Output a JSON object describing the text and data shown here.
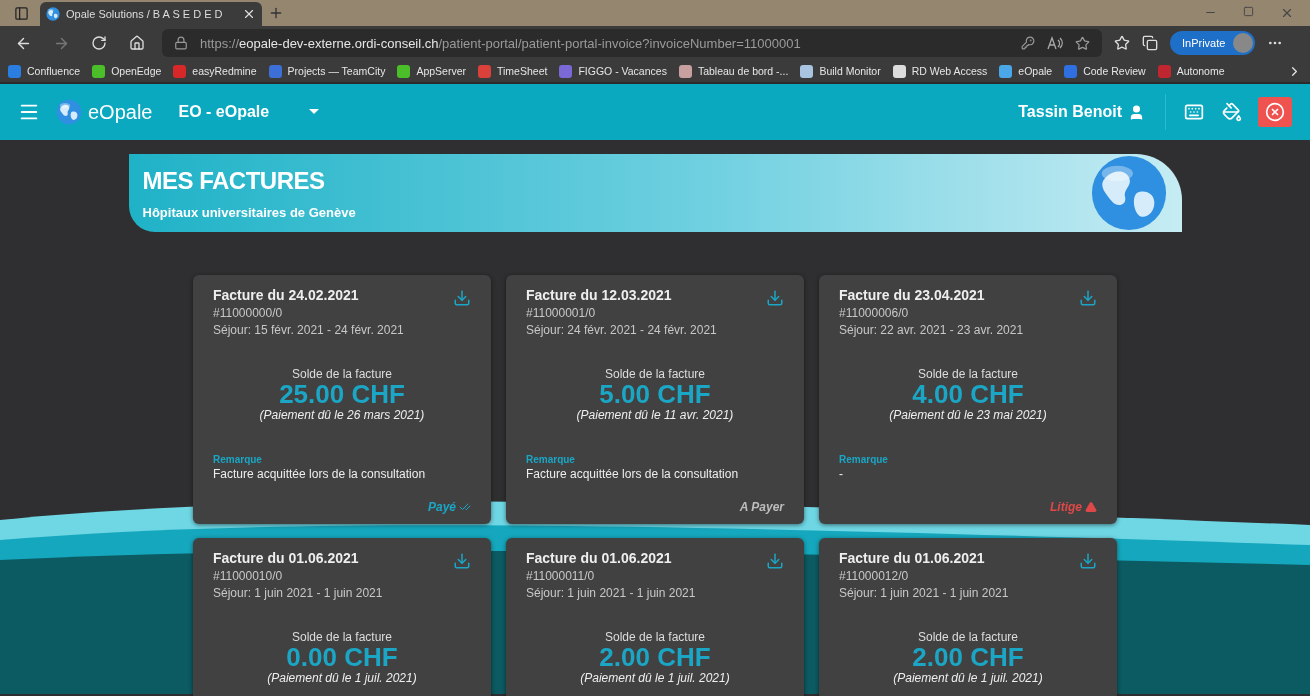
{
  "browser": {
    "tab_title": "Opale Solutions / B A S E D E D",
    "url": {
      "scheme": "https://",
      "host": "eopale-dev-externe.ordi-conseil.ch",
      "path": "/patient-portal/patient-portal-invoice?invoiceNumber=11000001"
    },
    "profile_label": "InPrivate",
    "bookmarks": [
      {
        "label": "Confluence",
        "color": "#2a7de1"
      },
      {
        "label": "OpenEdge",
        "color": "#4bbf2a"
      },
      {
        "label": "easyRedmine",
        "color": "#d62828"
      },
      {
        "label": "Projects — TeamCity",
        "color": "#3c6fd8"
      },
      {
        "label": "AppServer",
        "color": "#4bbf2a"
      },
      {
        "label": "TimeSheet",
        "color": "#d9413a"
      },
      {
        "label": "FIGGO - Vacances",
        "color": "#7a6ad8"
      },
      {
        "label": "Tableau de bord -...",
        "color": "#c9a0a0"
      },
      {
        "label": "Build Monitor",
        "color": "#a8c4e0"
      },
      {
        "label": "RD Web Access",
        "color": "#dddddd"
      },
      {
        "label": "eOpale",
        "color": "#4aa8e8"
      },
      {
        "label": "Code Review",
        "color": "#2f6fe0"
      },
      {
        "label": "Autonome",
        "color": "#c0262f"
      }
    ]
  },
  "app": {
    "brand": "eOpale",
    "workspace": "EO - eOpale",
    "user": "Tassin Benoit"
  },
  "banner": {
    "title": "MES FACTURES",
    "subtitle": "Hôpitaux universitaires de Genève"
  },
  "invoices": [
    {
      "title": "Facture du 24.02.2021",
      "number": "#11000000/0",
      "stay": "Séjour: 15 févr. 2021 - 24 févr. 2021",
      "balance_label": "Solde de la facture",
      "amount": "25.00 CHF",
      "due": "(Paiement dû le 26 mars 2021)",
      "remark_label": "Remarque",
      "remark": "Facture acquittée lors de la consultation",
      "status": {
        "kind": "paid",
        "label": "Payé"
      }
    },
    {
      "title": "Facture du 12.03.2021",
      "number": "#11000001/0",
      "stay": "Séjour: 24 févr. 2021 - 24 févr. 2021",
      "balance_label": "Solde de la facture",
      "amount": "5.00 CHF",
      "due": "(Paiement dû le 11 avr. 2021)",
      "remark_label": "Remarque",
      "remark": "Facture acquittée lors de la consultation",
      "status": {
        "kind": "topay",
        "label": "A Payer"
      }
    },
    {
      "title": "Facture du 23.04.2021",
      "number": "#11000006/0",
      "stay": "Séjour: 22 avr. 2021 - 23 avr. 2021",
      "balance_label": "Solde de la facture",
      "amount": "4.00 CHF",
      "due": "(Paiement dû le 23 mai 2021)",
      "remark_label": "Remarque",
      "remark": "-",
      "status": {
        "kind": "dispute",
        "label": "Litige"
      }
    },
    {
      "title": "Facture du 01.06.2021",
      "number": "#11000010/0",
      "stay": "Séjour: 1 juin 2021 - 1 juin 2021",
      "balance_label": "Solde de la facture",
      "amount": "0.00 CHF",
      "due": "(Paiement dû le 1 juil. 2021)"
    },
    {
      "title": "Facture du 01.06.2021",
      "number": "#11000011/0",
      "stay": "Séjour: 1 juin 2021 - 1 juin 2021",
      "balance_label": "Solde de la facture",
      "amount": "2.00 CHF",
      "due": "(Paiement dû le 1 juil. 2021)"
    },
    {
      "title": "Facture du 01.06.2021",
      "number": "#11000012/0",
      "stay": "Séjour: 1 juin 2021 - 1 juin 2021",
      "balance_label": "Solde de la facture",
      "amount": "2.00 CHF",
      "due": "(Paiement dû le 1 juil. 2021)"
    }
  ]
}
